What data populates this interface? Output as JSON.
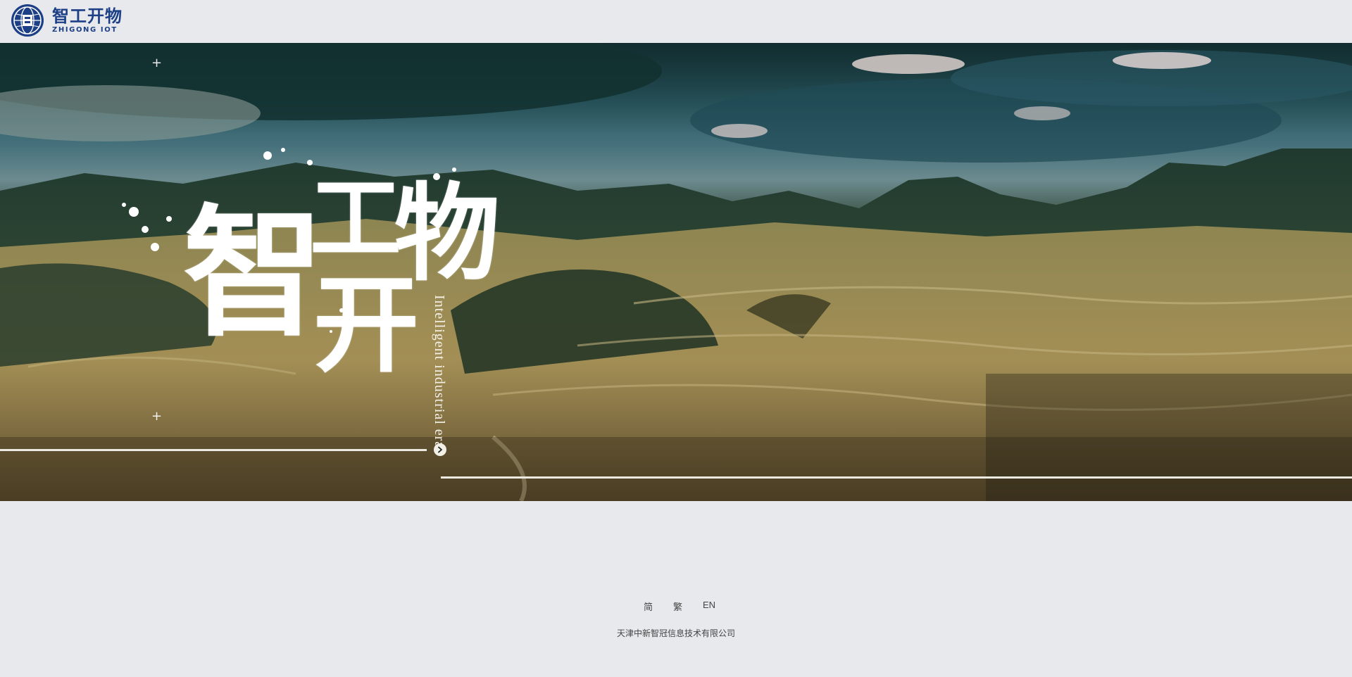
{
  "header": {
    "logo_cn": "智工开物",
    "logo_en": "ZHIGONG IOT"
  },
  "hero": {
    "title_chars": [
      "智",
      "工",
      "开",
      "物"
    ],
    "tagline": "Intelligent industrial era",
    "plus_marks": [
      "+",
      "+"
    ]
  },
  "footer": {
    "languages": [
      "简",
      "繁",
      "EN"
    ],
    "company": "天津中新智冠信息技术有限公司"
  },
  "colors": {
    "brand": "#1c3f86",
    "page_bg": "#e8e9ec",
    "text": "#444444"
  },
  "icons": {
    "logo": "globe-logo-icon",
    "next": "chevron-right-icon"
  }
}
